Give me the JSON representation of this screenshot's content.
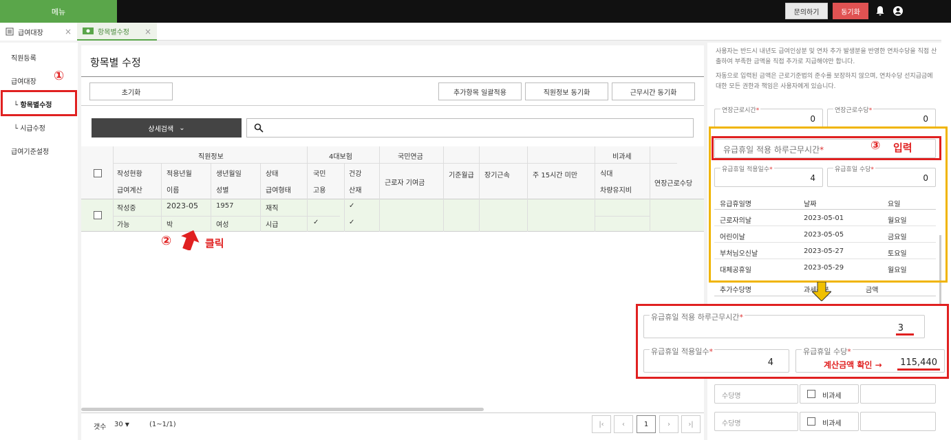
{
  "topbar": {
    "menu": "메뉴",
    "inquiry": "문의하기",
    "sync": "동기화"
  },
  "tabs": [
    {
      "label": "급여대장"
    },
    {
      "label": "항목별수정"
    }
  ],
  "sidebar": {
    "items": [
      {
        "label": "직원등록"
      },
      {
        "label": "급여대장"
      },
      {
        "label": "└ 항목별수정"
      },
      {
        "label": "└ 시급수정"
      },
      {
        "label": "급여기준설정"
      }
    ]
  },
  "main": {
    "title": "항목별 수정",
    "reset": "초기화",
    "bulk_apply": "추가항목 일괄적용",
    "emp_sync": "직원정보 동기화",
    "work_sync": "근무시간 동기화",
    "detail_search": "상세검색"
  },
  "grid": {
    "group_headers": {
      "emp": "직원정보",
      "ins": "4대보험",
      "pension": "국민연금",
      "nontax": "비과세"
    },
    "h1": [
      "작성현황",
      "적용년월",
      "생년월일",
      "상태",
      "국민",
      "건강"
    ],
    "h2": [
      "급여계산",
      "이름",
      "성별",
      "급여형태",
      "고용",
      "산재"
    ],
    "cols": {
      "pension_sub": "근로자 기여금",
      "base": "기준월급",
      "long": "장기근속",
      "under15": "주 15시간 미만",
      "meal": "식대",
      "car": "차량유지비",
      "ot": "연장근로수당"
    },
    "row1": [
      "작성중",
      "2023-05",
      "1957",
      "재직",
      "",
      "✓"
    ],
    "row2": [
      "가능",
      "박",
      "여성",
      "시급",
      "✓",
      "✓"
    ]
  },
  "footer": {
    "count_label": "갯수",
    "count": "30",
    "range": "(1~1/1)",
    "page": "1"
  },
  "right": {
    "note1": "사용자는 반드시 내년도 급여인상분 및 연차 추가 발생분을 반영한 연차수당을 직접 산출하여 부족한 금액을 직접 추가로 지급해야만 합니다.",
    "note2": "자동으로 입력된 금액은 근로기준법의 준수를 보장하지 않으며, 연차수당 선지급금에 대한 모든 권한과 책임은 사용자에게 있습니다.",
    "ot_hours_label": "연장근로시간",
    "ot_hours": "0",
    "ot_pay_label": "연장근로수당",
    "ot_pay": "0",
    "daily_hours_label": "유급휴일 적용 하루근무시간",
    "days_label": "유급휴일 적용일수",
    "days": "4",
    "pay_label": "유급휴일 수당",
    "pay": "0",
    "holiday_headers": [
      "유급휴일명",
      "날짜",
      "요일"
    ],
    "holidays": [
      [
        "근로자의날",
        "2023-05-01",
        "월요일"
      ],
      [
        "어린이날",
        "2023-05-05",
        "금요일"
      ],
      [
        "부처님오신날",
        "2023-05-27",
        "토요일"
      ],
      [
        "대체공휴일",
        "2023-05-29",
        "월요일"
      ]
    ],
    "extra_headers": [
      "추가수당명",
      "과세구분",
      "금액"
    ],
    "allow_name": "수당명",
    "nontax": "비과세"
  },
  "callout": {
    "daily_label": "유급휴일 적용 하루근무시간",
    "daily": "3",
    "days_label": "유급휴일 적용일수",
    "days": "4",
    "pay_label": "유급휴일 수당",
    "pay": "115,440",
    "confirm": "계산금액 확인 →"
  },
  "annotations": {
    "n1": "①",
    "n2": "②",
    "n3": "③",
    "click": "클릭",
    "input": "입력"
  }
}
